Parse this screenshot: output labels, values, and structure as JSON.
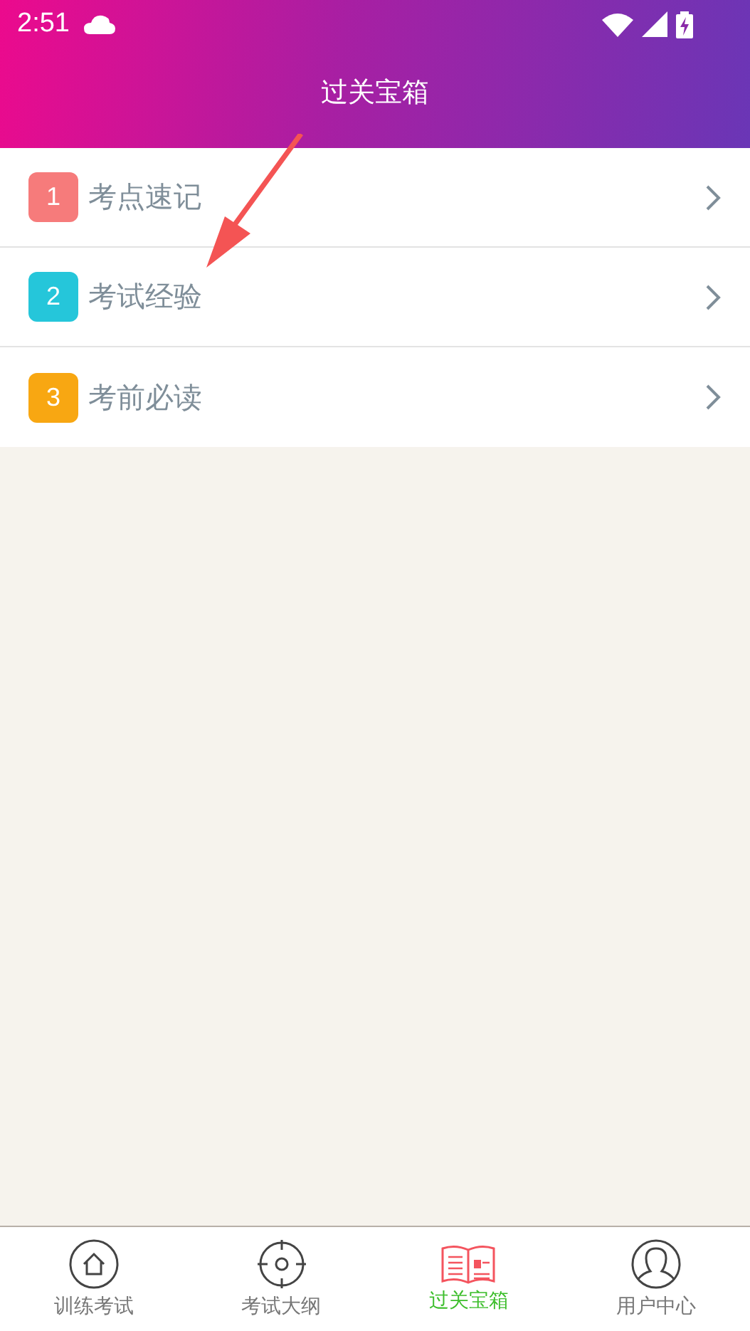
{
  "status_bar": {
    "time": "2:51"
  },
  "header": {
    "title": "过关宝箱"
  },
  "items": [
    {
      "number": "1",
      "label": "考点速记",
      "color": "#f67b7b"
    },
    {
      "number": "2",
      "label": "考试经验",
      "color": "#25c6da"
    },
    {
      "number": "3",
      "label": "考前必读",
      "color": "#f8a712"
    }
  ],
  "tabs": [
    {
      "kind": "home",
      "label": "训练考试",
      "selected": false
    },
    {
      "kind": "target",
      "label": "考试大纲",
      "selected": false
    },
    {
      "kind": "book",
      "label": "过关宝箱",
      "selected": true
    },
    {
      "kind": "user",
      "label": "用户中心",
      "selected": false
    }
  ]
}
